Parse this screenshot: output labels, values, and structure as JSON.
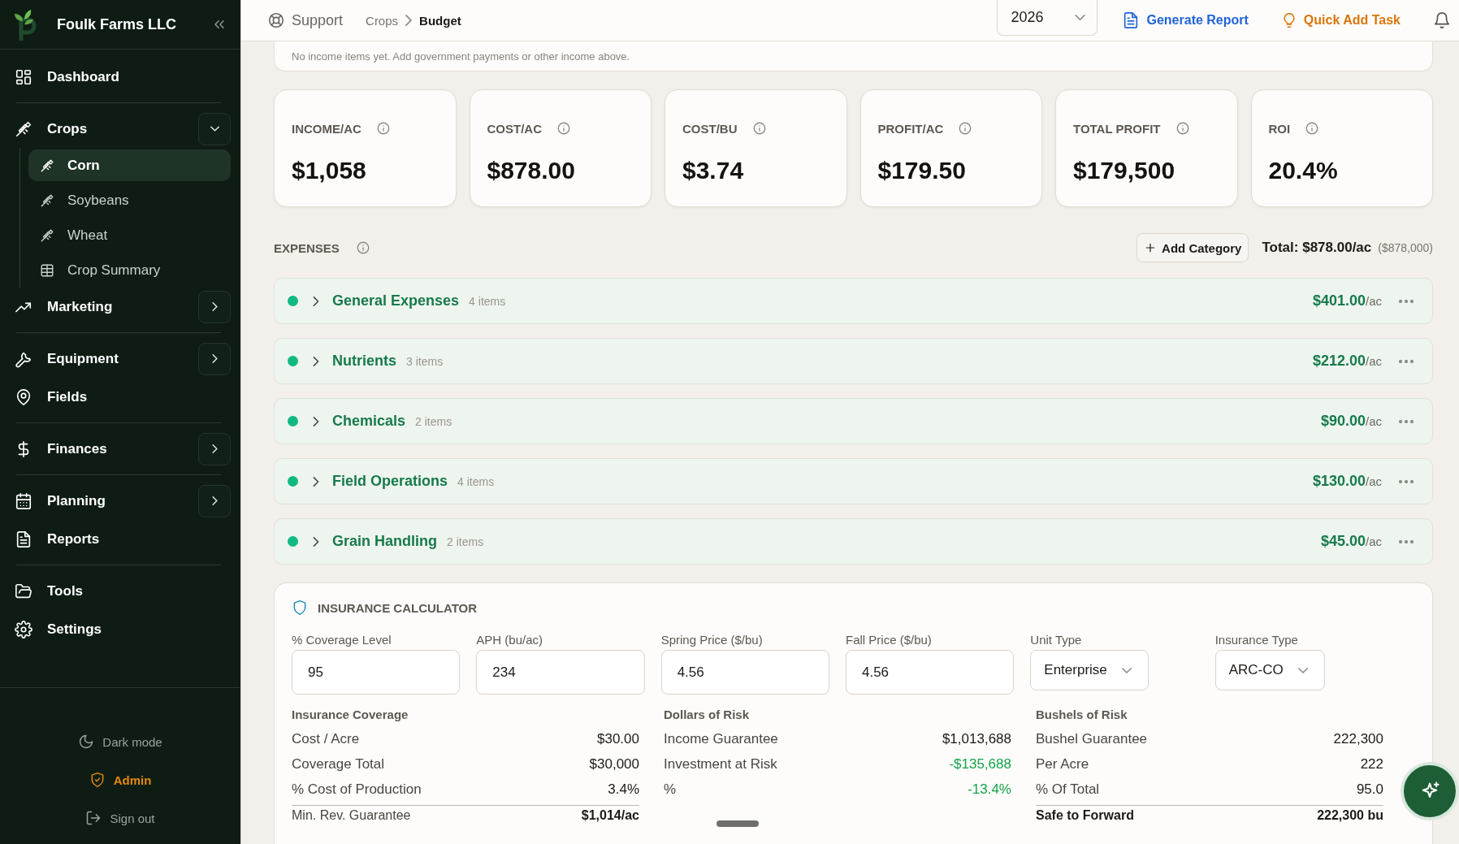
{
  "sidebar": {
    "brand": "Foulk Farms LLC",
    "items": [
      {
        "label": "Dashboard",
        "selected": false,
        "divider_after": true
      },
      {
        "label": "Crops",
        "expanded": true,
        "selected": false,
        "divider_after": false,
        "children": [
          {
            "label": "Corn",
            "selected": true
          },
          {
            "label": "Soybeans",
            "selected": false
          },
          {
            "label": "Wheat",
            "selected": false
          },
          {
            "label": "Crop Summary",
            "selected": false
          }
        ]
      },
      {
        "label": "Marketing",
        "expanded": false,
        "selected": false,
        "divider_after": true
      },
      {
        "label": "Equipment",
        "expanded": false,
        "selected": false,
        "divider_after": false
      },
      {
        "label": "Fields",
        "selected": false,
        "divider_after": true
      },
      {
        "label": "Finances",
        "expanded": false,
        "selected": false,
        "divider_after": true
      },
      {
        "label": "Planning",
        "expanded": false,
        "selected": false,
        "divider_after": false
      },
      {
        "label": "Reports",
        "selected": false,
        "divider_after": true
      },
      {
        "label": "Tools",
        "selected": false,
        "divider_after": false
      },
      {
        "label": "Settings",
        "selected": false,
        "divider_after": false
      }
    ],
    "footer": {
      "dark_mode": "Dark mode",
      "admin": "Admin",
      "sign_out": "Sign out"
    }
  },
  "header": {
    "support": "Support",
    "breadcrumb": [
      "Crops",
      "Budget"
    ],
    "year": "2026",
    "generate_report": "Generate Report",
    "quick_add_task": "Quick Add Task"
  },
  "income_notice": "No income items yet. Add government payments or other income above.",
  "stats": [
    {
      "label": "INCOME/AC",
      "value": "$1,058"
    },
    {
      "label": "COST/AC",
      "value": "$878.00"
    },
    {
      "label": "COST/BU",
      "value": "$3.74"
    },
    {
      "label": "PROFIT/AC",
      "value": "$179.50"
    },
    {
      "label": "TOTAL PROFIT",
      "value": "$179,500"
    },
    {
      "label": "ROI",
      "value": "20.4%"
    }
  ],
  "expenses": {
    "title": "EXPENSES",
    "add_button": "Add Category",
    "total": "Total: $878.00/ac",
    "total_sub": "($878,000)",
    "categories": [
      {
        "name": "General Expenses",
        "count": "4 items",
        "amount": "$401.00",
        "unit": "/ac",
        "color": "#10b981",
        "expanded": false
      },
      {
        "name": "Nutrients",
        "count": "3 items",
        "amount": "$212.00",
        "unit": "/ac",
        "color": "#10b981",
        "expanded": false
      },
      {
        "name": "Chemicals",
        "count": "2 items",
        "amount": "$90.00",
        "unit": "/ac",
        "color": "#10b981",
        "expanded": false
      },
      {
        "name": "Field Operations",
        "count": "4 items",
        "amount": "$130.00",
        "unit": "/ac",
        "color": "#10b981",
        "expanded": false
      },
      {
        "name": "Grain Handling",
        "count": "2 items",
        "amount": "$45.00",
        "unit": "/ac",
        "color": "#10b981",
        "expanded": false
      }
    ]
  },
  "insurance": {
    "title": "INSURANCE CALCULATOR",
    "fields": [
      {
        "label": "% Coverage Level",
        "value": "95",
        "kind": "input"
      },
      {
        "label": "APH (bu/ac)",
        "value": "234",
        "kind": "input"
      },
      {
        "label": "Spring Price ($/bu)",
        "value": "4.56",
        "kind": "input"
      },
      {
        "label": "Fall Price ($/bu)",
        "value": "4.56",
        "kind": "input"
      },
      {
        "label": "Unit Type",
        "value": "Enterprise",
        "kind": "select"
      },
      {
        "label": "Insurance Type",
        "value": "ARC-CO",
        "kind": "select"
      }
    ],
    "sections": [
      {
        "heading": "Insurance Coverage",
        "rows": [
          {
            "label": "Cost / Acre",
            "value": "$30.00",
            "positive": false
          },
          {
            "label": "Coverage Total",
            "value": "$30,000",
            "positive": false
          },
          {
            "label": "% Cost of Production",
            "value": "3.4%",
            "positive": false
          }
        ],
        "total": {
          "label": "Min. Rev. Guarantee",
          "value": "$1,014/ac"
        }
      },
      {
        "heading": "Dollars of Risk",
        "rows": [
          {
            "label": "Income Guarantee",
            "value": "$1,013,688",
            "positive": false
          },
          {
            "label": "Investment at Risk",
            "value": "-$135,688",
            "positive": true
          },
          {
            "label": "%",
            "value": "-13.4%",
            "positive": true
          }
        ]
      },
      {
        "heading": "Bushels of Risk",
        "rows": [
          {
            "label": "Bushel Guarantee",
            "value": "222,300",
            "positive": false
          },
          {
            "label": "Per Acre",
            "value": "222",
            "positive": false
          },
          {
            "label": "% Of Total",
            "value": "95.0",
            "positive": false
          }
        ],
        "total": {
          "label": "Safe to Forward",
          "value": "222,300 bu"
        }
      }
    ]
  }
}
